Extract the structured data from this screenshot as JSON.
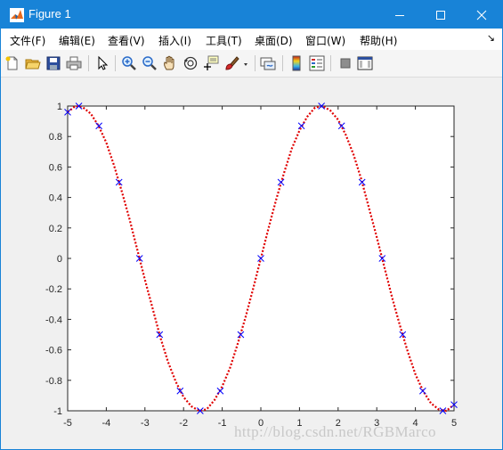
{
  "window": {
    "title": "Figure 1"
  },
  "menu": {
    "items": [
      "文件(F)",
      "编辑(E)",
      "查看(V)",
      "插入(I)",
      "工具(T)",
      "桌面(D)",
      "窗口(W)",
      "帮助(H)"
    ],
    "overflow": "↘"
  },
  "toolbar": {
    "icons": [
      "new-figure-icon",
      "open-file-icon",
      "save-icon",
      "print-icon",
      "pointer-icon",
      "zoom-in-icon",
      "zoom-out-icon",
      "pan-icon",
      "rotate-3d-icon",
      "data-cursor-icon",
      "brush-icon",
      "link-plot-icon",
      "colorbar-icon",
      "legend-icon",
      "hide-plot-tools-icon",
      "show-plot-tools-icon"
    ]
  },
  "watermark": "http://blog.csdn.net/RGBMarco",
  "colors": {
    "titlebar": "#1883d7",
    "curve": "#e00000",
    "markers": "#0000ff"
  },
  "chart_data": {
    "type": "line",
    "xlim": [
      -5,
      5
    ],
    "ylim": [
      -1,
      1
    ],
    "xticks": [
      -5,
      -4,
      -3,
      -2,
      -1,
      0,
      1,
      2,
      3,
      4,
      5
    ],
    "yticks": [
      -1,
      -0.8,
      -0.6,
      -0.4,
      -0.2,
      0,
      0.2,
      0.4,
      0.6,
      0.8,
      1
    ],
    "xtick_labels": [
      "-5",
      "-4",
      "-3",
      "-2",
      "-1",
      "0",
      "1",
      "2",
      "3",
      "4",
      "5"
    ],
    "ytick_labels": [
      "-1",
      "-0.8",
      "-0.6",
      "-0.4",
      "-0.2",
      "0",
      "0.2",
      "0.4",
      "0.6",
      "0.8",
      "1"
    ],
    "grid": false,
    "series": [
      {
        "style": "dotted-line",
        "color": "#e00000",
        "x": [
          -5.0,
          -4.8,
          -4.6,
          -4.4,
          -4.2,
          -4.0,
          -3.8,
          -3.6,
          -3.4,
          -3.2,
          -3.0,
          -2.8,
          -2.6,
          -2.4,
          -2.2,
          -2.0,
          -1.8,
          -1.6,
          -1.4,
          -1.2,
          -1.0,
          -0.8,
          -0.6,
          -0.4,
          -0.2,
          0.0,
          0.2,
          0.4,
          0.6,
          0.8,
          1.0,
          1.2,
          1.4,
          1.6,
          1.8,
          2.0,
          2.2,
          2.4,
          2.6,
          2.8,
          3.0,
          3.2,
          3.4,
          3.6,
          3.8,
          4.0,
          4.2,
          4.4,
          4.6,
          4.8,
          5.0
        ],
        "y": [
          0.96,
          1.0,
          0.99,
          0.95,
          0.87,
          0.76,
          0.61,
          0.44,
          0.26,
          0.06,
          -0.14,
          -0.33,
          -0.52,
          -0.68,
          -0.81,
          -0.91,
          -0.97,
          -1.0,
          -0.99,
          -0.93,
          -0.84,
          -0.72,
          -0.56,
          -0.39,
          -0.2,
          0.0,
          0.2,
          0.39,
          0.56,
          0.72,
          0.84,
          0.93,
          0.99,
          1.0,
          0.97,
          0.91,
          0.81,
          0.68,
          0.52,
          0.33,
          0.14,
          -0.06,
          -0.26,
          -0.44,
          -0.61,
          -0.76,
          -0.87,
          -0.95,
          -0.99,
          -1.0,
          -0.96
        ]
      },
      {
        "style": "x-markers",
        "color": "#0000ff",
        "x": [
          -5.0,
          -4.71,
          -4.19,
          -3.67,
          -3.14,
          -2.62,
          -2.09,
          -1.57,
          -1.05,
          -0.52,
          0.0,
          0.52,
          1.05,
          1.57,
          2.09,
          2.62,
          3.14,
          3.67,
          4.19,
          4.71,
          5.0
        ],
        "y": [
          0.96,
          1.0,
          0.87,
          0.5,
          0.0,
          -0.5,
          -0.87,
          -1.0,
          -0.87,
          -0.5,
          0.0,
          0.5,
          0.87,
          1.0,
          0.87,
          0.5,
          0.0,
          -0.5,
          -0.87,
          -1.0,
          -0.96
        ]
      }
    ]
  }
}
